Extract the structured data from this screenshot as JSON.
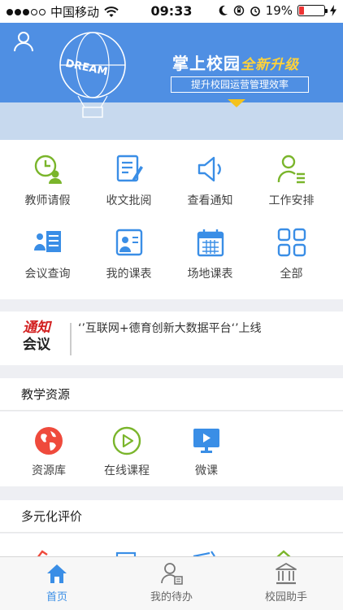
{
  "status_bar": {
    "carrier": "中国移动",
    "time": "09:33",
    "battery": "19%",
    "battery_level": 0.19
  },
  "banner": {
    "title": "掌上校园",
    "title_highlight": "全新升级",
    "subtitle": "提升校园运营管理效率",
    "balloon_text": "DREAM"
  },
  "grid": [
    {
      "label": "教师请假",
      "icon": "clock-user-icon"
    },
    {
      "label": "收文批阅",
      "icon": "document-edit-icon"
    },
    {
      "label": "查看通知",
      "icon": "speaker-icon"
    },
    {
      "label": "工作安排",
      "icon": "user-list-icon"
    },
    {
      "label": "会议查询",
      "icon": "meeting-icon"
    },
    {
      "label": "我的课表",
      "icon": "schedule-icon"
    },
    {
      "label": "场地课表",
      "icon": "calendar-icon"
    },
    {
      "label": "全部",
      "icon": "grid-icon"
    }
  ],
  "notice": {
    "logo_top": "通知",
    "logo_bottom": "会议",
    "text": "‘’互联网+德育创新大数据平台‘’上线"
  },
  "teaching_resources": {
    "title": "教学资源",
    "items": [
      {
        "label": "资源库",
        "icon": "globe-icon"
      },
      {
        "label": "在线课程",
        "icon": "play-circle-icon"
      },
      {
        "label": "微课",
        "icon": "monitor-play-icon"
      }
    ]
  },
  "evaluation": {
    "title": "多元化评价"
  },
  "tabbar": [
    {
      "label": "首页",
      "icon": "home-icon",
      "active": true
    },
    {
      "label": "我的待办",
      "icon": "user-todo-icon",
      "active": false
    },
    {
      "label": "校园助手",
      "icon": "building-icon",
      "active": false
    }
  ],
  "colors": {
    "accent": "#3a8ee6",
    "green": "#7ab52b",
    "banner": "#4f8fe3"
  }
}
